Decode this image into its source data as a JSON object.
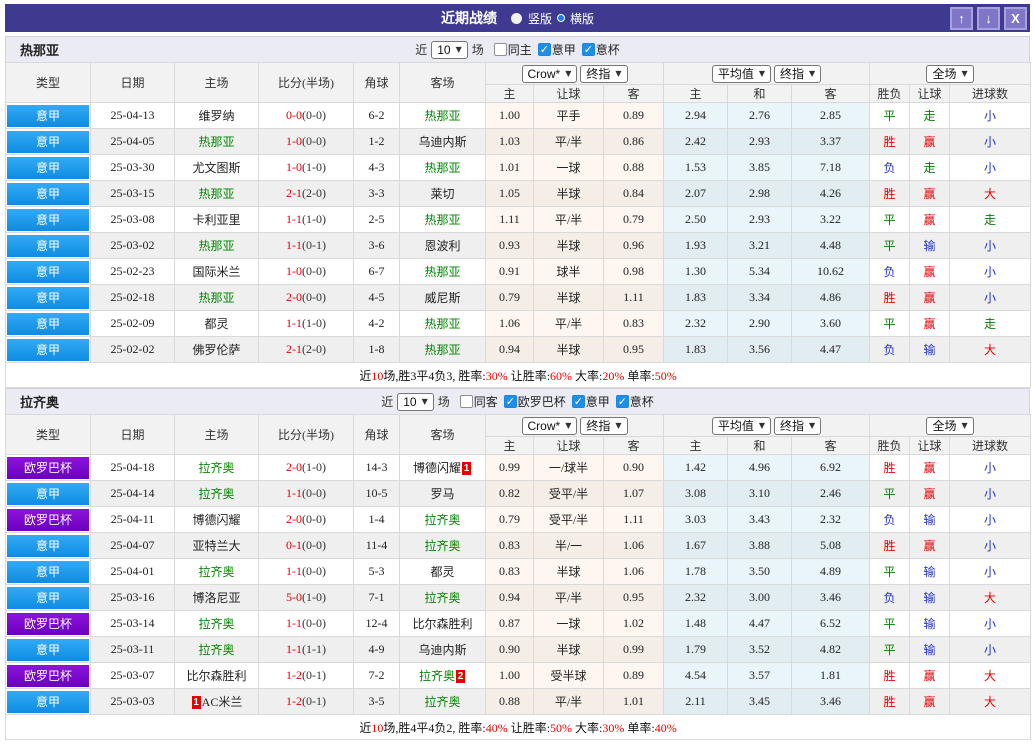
{
  "titlebar": {
    "title": "近期战绩",
    "options": [
      {
        "label": "竖版",
        "selected": false
      },
      {
        "label": "横版",
        "selected": true
      }
    ],
    "icons": {
      "up": "↑",
      "down": "↓",
      "close": "X"
    }
  },
  "table_header": {
    "cols": [
      "类型",
      "日期",
      "主场",
      "比分(半场)",
      "角球",
      "客场"
    ],
    "sub_cols": [
      "主",
      "让球",
      "客",
      "主",
      "和",
      "客",
      "胜负",
      "让球",
      "进球数"
    ],
    "dropdowns": {
      "bookmaker": "Crow*",
      "final_odds": "终指",
      "average": "平均值",
      "final_odds2": "终指",
      "fulltime": "全场"
    }
  },
  "colors": {
    "titlebar": "#3E3A90",
    "league_serie_a": "#159BF0",
    "league_europa": "#7D0ACD",
    "self_team": "#008800",
    "win_red": "#E60000",
    "draw_green": "#008000",
    "lose_blue": "#2431CC"
  },
  "sections": [
    {
      "team": "热那亚",
      "filter": {
        "prefix": "近",
        "count": "10",
        "suffix": "场",
        "checks": [
          {
            "label": "同主",
            "checked": false
          },
          {
            "label": "意甲",
            "checked": true
          },
          {
            "label": "意杯",
            "checked": true
          }
        ]
      },
      "rows": [
        {
          "league": "意甲",
          "league_color": "blue",
          "date": "25-04-13",
          "home": {
            "name": "维罗纳"
          },
          "score_ft": "0-0",
          "score_ht": "(0-0)",
          "corners": "6-2",
          "away": {
            "name": "热那亚",
            "self": true
          },
          "odds": [
            "1.00",
            "平手",
            "0.89"
          ],
          "averages": [
            "2.94",
            "2.76",
            "2.85"
          ],
          "results": [
            "平",
            "走",
            "小"
          ]
        },
        {
          "league": "意甲",
          "league_color": "blue",
          "date": "25-04-05",
          "home": {
            "name": "热那亚",
            "self": true
          },
          "score_ft": "1-0",
          "score_ht": "(0-0)",
          "corners": "1-2",
          "away": {
            "name": "乌迪内斯"
          },
          "odds": [
            "1.03",
            "平/半",
            "0.86"
          ],
          "averages": [
            "2.42",
            "2.93",
            "3.37"
          ],
          "results": [
            "胜",
            "赢",
            "小"
          ]
        },
        {
          "league": "意甲",
          "league_color": "blue",
          "date": "25-03-30",
          "home": {
            "name": "尤文图斯"
          },
          "score_ft": "1-0",
          "score_ht": "(1-0)",
          "corners": "4-3",
          "away": {
            "name": "热那亚",
            "self": true
          },
          "odds": [
            "1.01",
            "一球",
            "0.88"
          ],
          "averages": [
            "1.53",
            "3.85",
            "7.18"
          ],
          "results": [
            "负",
            "走",
            "小"
          ]
        },
        {
          "league": "意甲",
          "league_color": "blue",
          "date": "25-03-15",
          "home": {
            "name": "热那亚",
            "self": true
          },
          "score_ft": "2-1",
          "score_ht": "(2-0)",
          "corners": "3-3",
          "away": {
            "name": "莱切"
          },
          "odds": [
            "1.05",
            "半球",
            "0.84"
          ],
          "averages": [
            "2.07",
            "2.98",
            "4.26"
          ],
          "results": [
            "胜",
            "赢",
            "大"
          ]
        },
        {
          "league": "意甲",
          "league_color": "blue",
          "date": "25-03-08",
          "home": {
            "name": "卡利亚里"
          },
          "score_ft": "1-1",
          "score_ht": "(1-0)",
          "corners": "2-5",
          "away": {
            "name": "热那亚",
            "self": true
          },
          "odds": [
            "1.11",
            "平/半",
            "0.79"
          ],
          "averages": [
            "2.50",
            "2.93",
            "3.22"
          ],
          "results": [
            "平",
            "赢",
            "走"
          ]
        },
        {
          "league": "意甲",
          "league_color": "blue",
          "date": "25-03-02",
          "home": {
            "name": "热那亚",
            "self": true
          },
          "score_ft": "1-1",
          "score_ht": "(0-1)",
          "corners": "3-6",
          "away": {
            "name": "恩波利"
          },
          "odds": [
            "0.93",
            "半球",
            "0.96"
          ],
          "averages": [
            "1.93",
            "3.21",
            "4.48"
          ],
          "results": [
            "平",
            "输",
            "小"
          ]
        },
        {
          "league": "意甲",
          "league_color": "blue",
          "date": "25-02-23",
          "home": {
            "name": "国际米兰"
          },
          "score_ft": "1-0",
          "score_ht": "(0-0)",
          "corners": "6-7",
          "away": {
            "name": "热那亚",
            "self": true
          },
          "odds": [
            "0.91",
            "球半",
            "0.98"
          ],
          "averages": [
            "1.30",
            "5.34",
            "10.62"
          ],
          "results": [
            "负",
            "赢",
            "小"
          ]
        },
        {
          "league": "意甲",
          "league_color": "blue",
          "date": "25-02-18",
          "home": {
            "name": "热那亚",
            "self": true
          },
          "score_ft": "2-0",
          "score_ht": "(0-0)",
          "corners": "4-5",
          "away": {
            "name": "威尼斯"
          },
          "odds": [
            "0.79",
            "半球",
            "1.11"
          ],
          "averages": [
            "1.83",
            "3.34",
            "4.86"
          ],
          "results": [
            "胜",
            "赢",
            "小"
          ]
        },
        {
          "league": "意甲",
          "league_color": "blue",
          "date": "25-02-09",
          "home": {
            "name": "都灵"
          },
          "score_ft": "1-1",
          "score_ht": "(1-0)",
          "corners": "4-2",
          "away": {
            "name": "热那亚",
            "self": true
          },
          "odds": [
            "1.06",
            "平/半",
            "0.83"
          ],
          "averages": [
            "2.32",
            "2.90",
            "3.60"
          ],
          "results": [
            "平",
            "赢",
            "走"
          ]
        },
        {
          "league": "意甲",
          "league_color": "blue",
          "date": "25-02-02",
          "home": {
            "name": "佛罗伦萨"
          },
          "score_ft": "2-1",
          "score_ht": "(2-0)",
          "corners": "1-8",
          "away": {
            "name": "热那亚",
            "self": true
          },
          "odds": [
            "0.94",
            "半球",
            "0.95"
          ],
          "averages": [
            "1.83",
            "3.56",
            "4.47"
          ],
          "results": [
            "负",
            "输",
            "大"
          ]
        }
      ],
      "summary": [
        {
          "t": "近"
        },
        {
          "t": "10",
          "red": true
        },
        {
          "t": "场,胜3平4负3, 胜率:"
        },
        {
          "t": "30%",
          "red": true
        },
        {
          "t": " 让胜率:"
        },
        {
          "t": "60%",
          "red": true
        },
        {
          "t": " 大率:"
        },
        {
          "t": "20%",
          "red": true
        },
        {
          "t": " 单率:"
        },
        {
          "t": "50%",
          "red": true
        }
      ]
    },
    {
      "team": "拉齐奥",
      "filter": {
        "prefix": "近",
        "count": "10",
        "suffix": "场",
        "checks": [
          {
            "label": "同客",
            "checked": false
          },
          {
            "label": "欧罗巴杯",
            "checked": true
          },
          {
            "label": "意甲",
            "checked": true
          },
          {
            "label": "意杯",
            "checked": true
          }
        ]
      },
      "rows": [
        {
          "league": "欧罗巴杯",
          "league_color": "purple",
          "date": "25-04-18",
          "home": {
            "name": "拉齐奥",
            "self": true
          },
          "score_ft": "2-0",
          "score_ht": "(1-0)",
          "corners": "14-3",
          "away": {
            "name": "博德闪耀",
            "badge": "1",
            "badge_pos": "after"
          },
          "odds": [
            "0.99",
            "一/球半",
            "0.90"
          ],
          "averages": [
            "1.42",
            "4.96",
            "6.92"
          ],
          "results": [
            "胜",
            "赢",
            "小"
          ]
        },
        {
          "league": "意甲",
          "league_color": "blue",
          "date": "25-04-14",
          "home": {
            "name": "拉齐奥",
            "self": true
          },
          "score_ft": "1-1",
          "score_ht": "(0-0)",
          "corners": "10-5",
          "away": {
            "name": "罗马"
          },
          "odds": [
            "0.82",
            "受平/半",
            "1.07"
          ],
          "averages": [
            "3.08",
            "3.10",
            "2.46"
          ],
          "results": [
            "平",
            "赢",
            "小"
          ]
        },
        {
          "league": "欧罗巴杯",
          "league_color": "purple",
          "date": "25-04-11",
          "home": {
            "name": "博德闪耀"
          },
          "score_ft": "2-0",
          "score_ht": "(0-0)",
          "corners": "1-4",
          "away": {
            "name": "拉齐奥",
            "self": true
          },
          "odds": [
            "0.79",
            "受平/半",
            "1.11"
          ],
          "averages": [
            "3.03",
            "3.43",
            "2.32"
          ],
          "results": [
            "负",
            "输",
            "小"
          ]
        },
        {
          "league": "意甲",
          "league_color": "blue",
          "date": "25-04-07",
          "home": {
            "name": "亚特兰大"
          },
          "score_ft": "0-1",
          "score_ht": "(0-0)",
          "corners": "11-4",
          "away": {
            "name": "拉齐奥",
            "self": true
          },
          "odds": [
            "0.83",
            "半/一",
            "1.06"
          ],
          "averages": [
            "1.67",
            "3.88",
            "5.08"
          ],
          "results": [
            "胜",
            "赢",
            "小"
          ]
        },
        {
          "league": "意甲",
          "league_color": "blue",
          "date": "25-04-01",
          "home": {
            "name": "拉齐奥",
            "self": true
          },
          "score_ft": "1-1",
          "score_ht": "(0-0)",
          "corners": "5-3",
          "away": {
            "name": "都灵"
          },
          "odds": [
            "0.83",
            "半球",
            "1.06"
          ],
          "averages": [
            "1.78",
            "3.50",
            "4.89"
          ],
          "results": [
            "平",
            "输",
            "小"
          ]
        },
        {
          "league": "意甲",
          "league_color": "blue",
          "date": "25-03-16",
          "home": {
            "name": "博洛尼亚"
          },
          "score_ft": "5-0",
          "score_ht": "(1-0)",
          "corners": "7-1",
          "away": {
            "name": "拉齐奥",
            "self": true
          },
          "odds": [
            "0.94",
            "平/半",
            "0.95"
          ],
          "averages": [
            "2.32",
            "3.00",
            "3.46"
          ],
          "results": [
            "负",
            "输",
            "大"
          ]
        },
        {
          "league": "欧罗巴杯",
          "league_color": "purple",
          "date": "25-03-14",
          "home": {
            "name": "拉齐奥",
            "self": true
          },
          "score_ft": "1-1",
          "score_ht": "(0-0)",
          "corners": "12-4",
          "away": {
            "name": "比尔森胜利"
          },
          "odds": [
            "0.87",
            "一球",
            "1.02"
          ],
          "averages": [
            "1.48",
            "4.47",
            "6.52"
          ],
          "results": [
            "平",
            "输",
            "小"
          ]
        },
        {
          "league": "意甲",
          "league_color": "blue",
          "date": "25-03-11",
          "home": {
            "name": "拉齐奥",
            "self": true
          },
          "score_ft": "1-1",
          "score_ht": "(1-1)",
          "corners": "4-9",
          "away": {
            "name": "乌迪内斯"
          },
          "odds": [
            "0.90",
            "半球",
            "0.99"
          ],
          "averages": [
            "1.79",
            "3.52",
            "4.82"
          ],
          "results": [
            "平",
            "输",
            "小"
          ]
        },
        {
          "league": "欧罗巴杯",
          "league_color": "purple",
          "date": "25-03-07",
          "home": {
            "name": "比尔森胜利"
          },
          "score_ft": "1-2",
          "score_ht": "(0-1)",
          "corners": "7-2",
          "away": {
            "name": "拉齐奥",
            "self": true,
            "badge": "2",
            "badge_pos": "after"
          },
          "odds": [
            "1.00",
            "受半球",
            "0.89"
          ],
          "averages": [
            "4.54",
            "3.57",
            "1.81"
          ],
          "results": [
            "胜",
            "赢",
            "大"
          ]
        },
        {
          "league": "意甲",
          "league_color": "blue",
          "date": "25-03-03",
          "home": {
            "name": "AC米兰",
            "badge": "1",
            "badge_pos": "before"
          },
          "score_ft": "1-2",
          "score_ht": "(0-1)",
          "corners": "3-5",
          "away": {
            "name": "拉齐奥",
            "self": true
          },
          "odds": [
            "0.88",
            "平/半",
            "1.01"
          ],
          "averages": [
            "2.11",
            "3.45",
            "3.46"
          ],
          "results": [
            "胜",
            "赢",
            "大"
          ]
        }
      ],
      "summary": [
        {
          "t": "近"
        },
        {
          "t": "10",
          "red": true
        },
        {
          "t": "场,胜4平4负2, 胜率:"
        },
        {
          "t": "40%",
          "red": true
        },
        {
          "t": " 让胜率:"
        },
        {
          "t": "50%",
          "red": true
        },
        {
          "t": " 大率:"
        },
        {
          "t": "30%",
          "red": true
        },
        {
          "t": " 单率:"
        },
        {
          "t": "40%",
          "red": true
        }
      ]
    }
  ]
}
